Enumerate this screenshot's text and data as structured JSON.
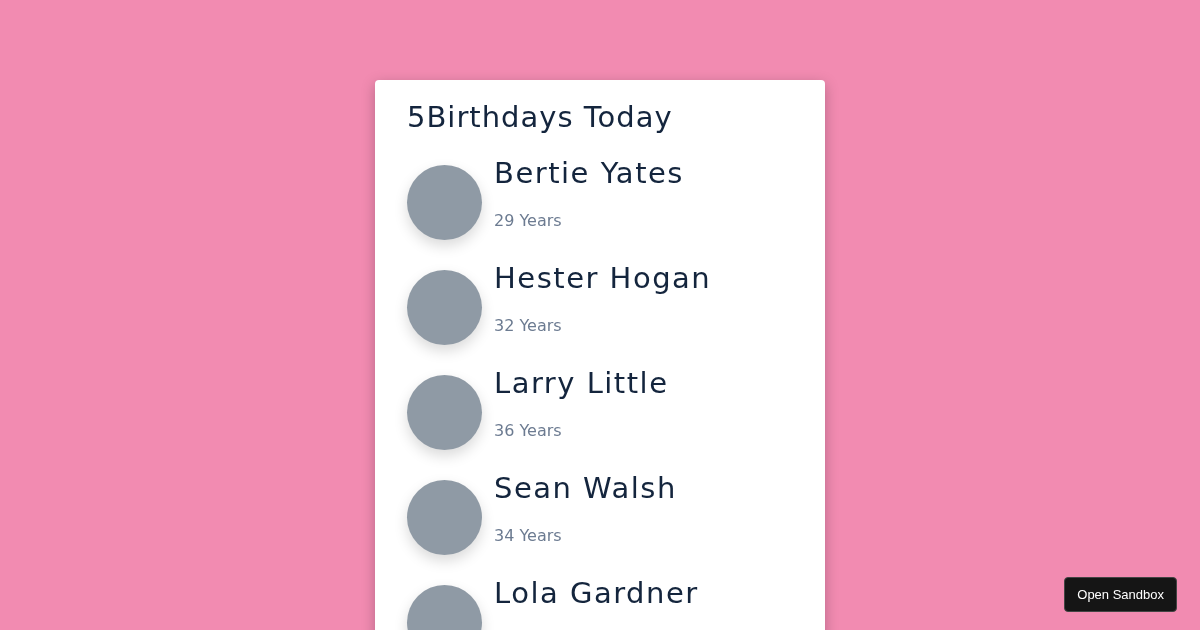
{
  "card": {
    "title": "5Birthdays Today",
    "people": [
      {
        "name": "Bertie Yates",
        "age": "29 Years"
      },
      {
        "name": "Hester Hogan",
        "age": "32 Years"
      },
      {
        "name": "Larry Little",
        "age": "36 Years"
      },
      {
        "name": "Sean Walsh",
        "age": "34 Years"
      },
      {
        "name": "Lola Gardner"
      }
    ]
  },
  "sandbox_button": "Open Sandbox"
}
